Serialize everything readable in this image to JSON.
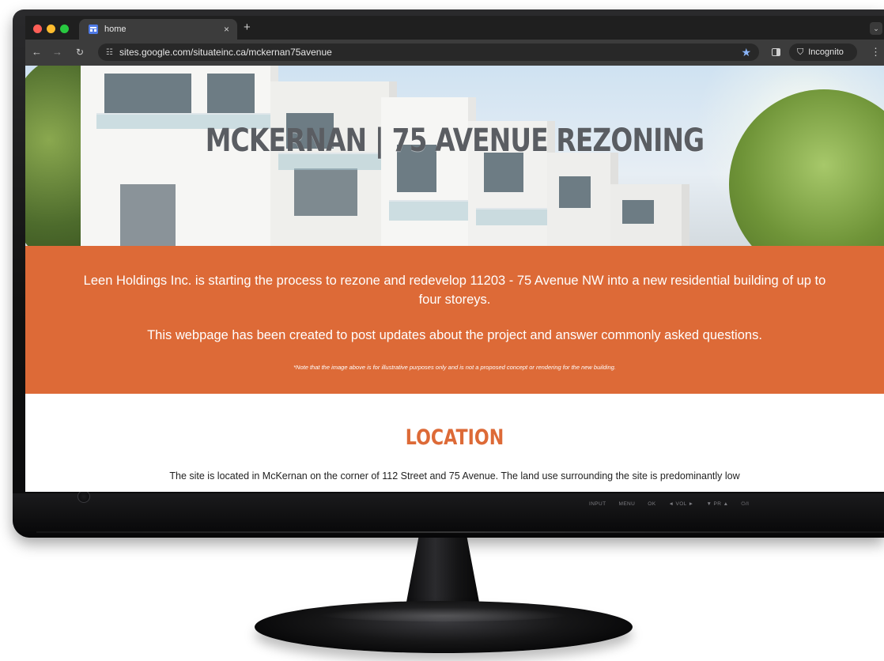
{
  "browser": {
    "tab": {
      "title": "home",
      "close_label": "×"
    },
    "new_tab_label": "+",
    "tab_menu_label": "⌄",
    "url": "sites.google.com/situateinc.ca/mckernan75avenue",
    "incognito_label": "Incognito"
  },
  "hero": {
    "title": "MCKERNAN | 75 AVENUE REZONING"
  },
  "banner": {
    "paragraph1": "Leen Holdings Inc. is starting the process to rezone and redevelop 11203 - 75 Avenue NW into a new residential building of up to four storeys.",
    "paragraph2": "This webpage has been created to post updates about the project and answer commonly asked questions.",
    "note": "*Note that the image above is for illustrative purposes only and is not a proposed concept or rendering for the new building.",
    "color": "#dd6a37"
  },
  "location": {
    "title": "LOCATION",
    "text": "The site is located in McKernan on the corner of 112 Street and 75 Avenue. The land use surrounding the site is predominantly low"
  },
  "monitor": {
    "controls": [
      "INPUT",
      "MENU",
      "OK",
      "◄ VOL ►",
      "▼ PR ▲",
      "⏻/I"
    ]
  },
  "icons": {
    "back": "arrow-left-icon",
    "forward": "arrow-right-icon",
    "reload": "reload-icon",
    "site_info": "tune-icon",
    "bookmark": "star-icon",
    "side_panel": "side-panel-icon",
    "incognito": "incognito-icon",
    "menu": "kebab-menu-icon"
  }
}
